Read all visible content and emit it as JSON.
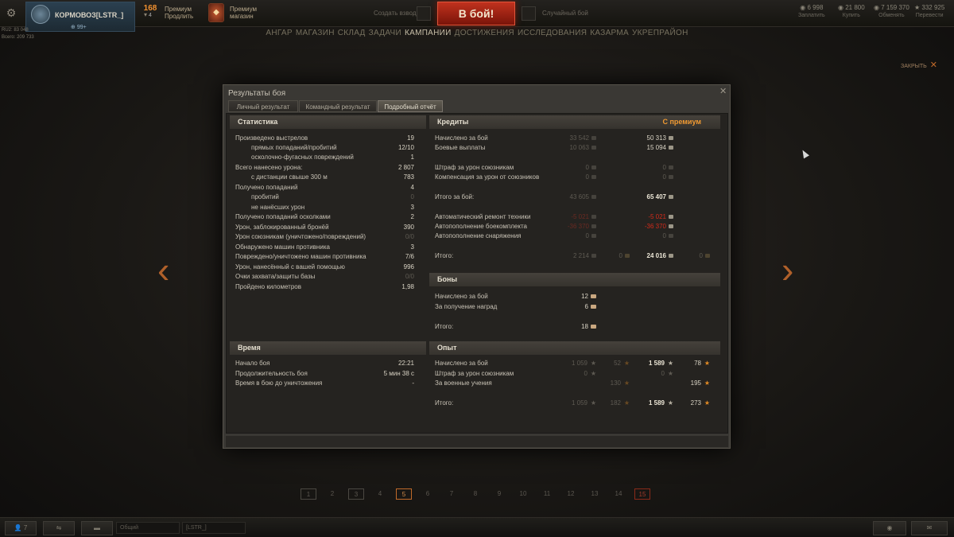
{
  "topbar": {
    "player_name": "КОРМОВОЗ[LSTR_]",
    "player_plus": "99+",
    "stat1": "RU2: 83 048",
    "stat2": "Всего: 209 733",
    "premium_count": "168",
    "premium_sub": "4",
    "premium_link_line1": "Премиум",
    "premium_link_line2": "Продлить",
    "shop_line1": "Премиум",
    "shop_line2": "магазин",
    "platoon_label": "Создать взвод",
    "battle_button": "В бой!",
    "mode_label": "Случайный бой",
    "resources": [
      {
        "value": "6 998",
        "label": "Заплатить"
      },
      {
        "value": "21 800",
        "label": "Купить"
      },
      {
        "value": "7 159 370",
        "label": "Обменять"
      },
      {
        "value": "332 925",
        "label": "Перевести"
      }
    ]
  },
  "nav": [
    "АНГАР",
    "МАГАЗИН",
    "СКЛАД",
    "ЗАДАЧИ",
    "КАМПАНИИ",
    "ДОСТИЖЕНИЯ",
    "ИССЛЕДОВАНИЯ",
    "КАЗАРМА",
    "УКРЕПРАЙОН"
  ],
  "nav_active": "КАМПАНИИ",
  "close_label": "ЗАКРЫТЬ",
  "modal": {
    "title": "Результаты боя",
    "tabs": [
      "Личный результат",
      "Командный результат",
      "Подробный отчёт"
    ],
    "stats": {
      "header": "Статистика",
      "rows": [
        {
          "label": "Произведено выстрелов",
          "value": "19",
          "indent": 0,
          "dim": false
        },
        {
          "label": "прямых попаданий/пробитий",
          "value": "12/10",
          "indent": 1,
          "dim": false
        },
        {
          "label": "осколочно-фугасных повреждений",
          "value": "1",
          "indent": 1,
          "dim": false
        },
        {
          "label": "Всего нанесено урона:",
          "value": "2 807",
          "indent": 0,
          "dim": false
        },
        {
          "label": "с дистанции свыше 300 м",
          "value": "783",
          "indent": 1,
          "dim": false
        },
        {
          "label": "Получено попаданий",
          "value": "4",
          "indent": 0,
          "dim": false
        },
        {
          "label": "пробитий",
          "value": "0",
          "indent": 1,
          "dim": true
        },
        {
          "label": "не нанёсших урон",
          "value": "3",
          "indent": 1,
          "dim": false
        },
        {
          "label": "Получено попаданий осколками",
          "value": "2",
          "indent": 0,
          "dim": false
        },
        {
          "label": "Урон, заблокированный бронёй",
          "value": "390",
          "indent": 0,
          "dim": false
        },
        {
          "label": "Урон союзникам (уничтожено/повреждений)",
          "value": "0/0",
          "indent": 0,
          "dim": true
        },
        {
          "label": "Обнаружено машин противника",
          "value": "3",
          "indent": 0,
          "dim": false
        },
        {
          "label": "Повреждено/уничтожено машин противника",
          "value": "7/6",
          "indent": 0,
          "dim": false
        },
        {
          "label": "Урон, нанесённый с вашей помощью",
          "value": "996",
          "indent": 0,
          "dim": false
        },
        {
          "label": "Очки захвата/защиты базы",
          "value": "0/0",
          "indent": 0,
          "dim": true
        },
        {
          "label": "Пройдено километров",
          "value": "1,98",
          "indent": 0,
          "dim": false
        }
      ]
    },
    "time": {
      "header": "Время",
      "rows": [
        {
          "label": "Начало боя",
          "value": "22:21"
        },
        {
          "label": "Продолжительность боя",
          "value": "5 мин 38 с"
        },
        {
          "label": "Время в бою до уничтожения",
          "value": "-"
        }
      ]
    },
    "credits": {
      "header": "Кредиты",
      "premium_header": "С премиум",
      "rows": [
        {
          "label": "Начислено за бой",
          "base": "33 542",
          "prem": "50 313"
        },
        {
          "label": "Боевые выплаты",
          "base": "10 063",
          "prem": "15 094"
        },
        {
          "label": "Штраф за урон союзникам",
          "base": "0",
          "prem": "0"
        },
        {
          "label": "Компенсация за урон от союзников",
          "base": "0",
          "prem": "0"
        },
        {
          "label": "Итого за бой:",
          "base": "43 605",
          "prem": "65 407"
        },
        {
          "label": "Автоматический ремонт техники",
          "base": "-5 021",
          "prem": "-5 021"
        },
        {
          "label": "Автопополнение боекомплекта",
          "base": "-36 370",
          "prem": "-36 370"
        },
        {
          "label": "Автопополнение снаряжения",
          "base": "0",
          "prem": "0"
        },
        {
          "label": "Итого:",
          "base": "2 214",
          "base_gold": "0",
          "prem": "24 016",
          "prem_gold": "0"
        }
      ]
    },
    "bonds": {
      "header": "Боны",
      "rows": [
        {
          "label": "Начислено за бой",
          "value": "12"
        },
        {
          "label": "За получение наград",
          "value": "6"
        },
        {
          "label": "Итого:",
          "value": "18"
        }
      ]
    },
    "experience": {
      "header": "Опыт",
      "rows": [
        {
          "label": "Начислено за бой",
          "base": "1 059",
          "base_free": "52",
          "prem": "1 589",
          "prem_free": "78"
        },
        {
          "label": "Штраф за урон союзникам",
          "base": "0",
          "base_free": "",
          "prem": "0",
          "prem_free": ""
        },
        {
          "label": "За военные учения",
          "base": "",
          "base_free": "130",
          "prem": "",
          "prem_free": "195"
        },
        {
          "label": "Итого:",
          "base": "1 059",
          "base_free": "182",
          "prem": "1 589",
          "prem_free": "273"
        }
      ]
    }
  },
  "pages": [
    "1",
    "2",
    "3",
    "4",
    "5",
    "6",
    "7",
    "8",
    "9",
    "10",
    "11",
    "12",
    "13",
    "14",
    "15"
  ],
  "current_page": "5",
  "bottom": {
    "friends_count": "7",
    "channel1": "Общий",
    "channel2": "[LSTR_]"
  },
  "colors": {
    "accent_orange": "#f09a32",
    "battle_red": "#c0321e",
    "negative_red": "#d02a1a"
  }
}
